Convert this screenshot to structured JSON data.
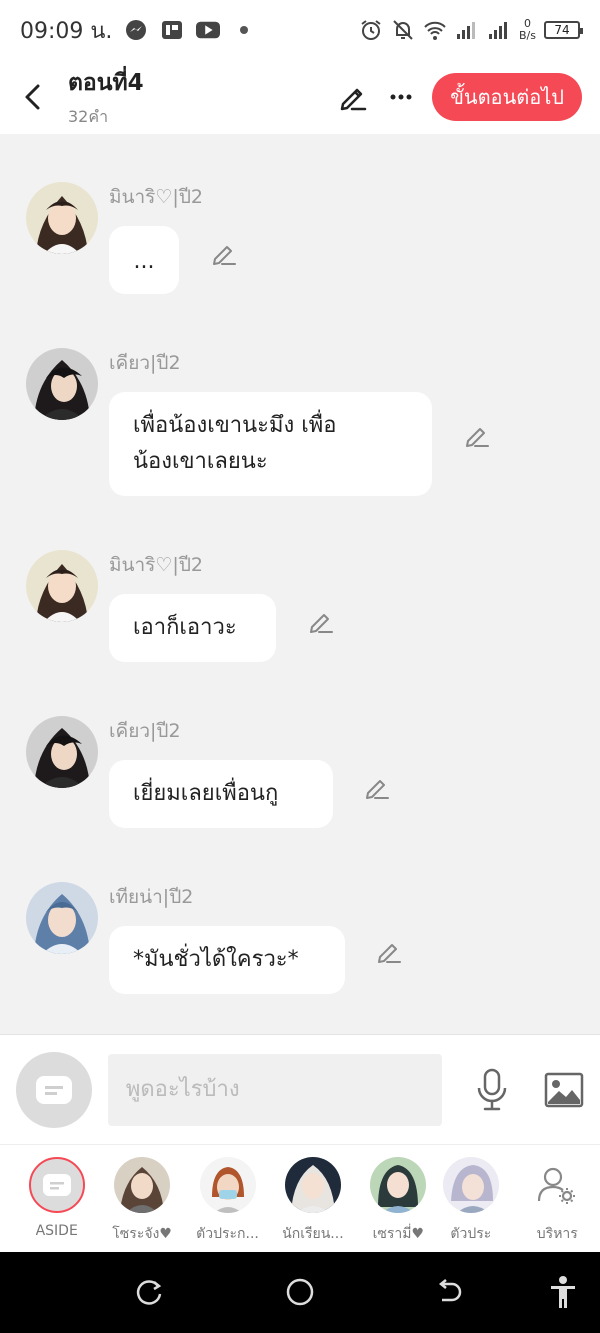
{
  "status_bar": {
    "time": "09:09 น.",
    "net_speed_value": "0",
    "net_speed_unit": "B/s",
    "battery": "74"
  },
  "header": {
    "title": "ตอนที่4",
    "subtitle": "32คำ",
    "next_label": "ขั้นตอนต่อไป"
  },
  "messages": [
    {
      "sender": "มินาริ♡|ปี2",
      "text": "..."
    },
    {
      "sender": "เคียว|ปี2",
      "text_line1": "เพื่อน้องเขานะมึง เพื่อ",
      "text_line2": "น้องเขาเลยนะ"
    },
    {
      "sender": "มินาริ♡|ปี2",
      "text": "เอาก็เอาวะ"
    },
    {
      "sender": "เคียว|ปี2",
      "text": "เยี่ยมเลยเพื่อนกู"
    },
    {
      "sender": "เทียน่า|ปี2",
      "text": "*มันชั่วได้ใครวะ*"
    }
  ],
  "input": {
    "placeholder": "พูดอะไรบ้าง"
  },
  "characters": [
    {
      "name": "ASIDE"
    },
    {
      "name": "โซระจัง♥"
    },
    {
      "name": "ตัวประก..."
    },
    {
      "name": "นักเรียน..."
    },
    {
      "name": "เซรามี่♥"
    },
    {
      "name": "ตัวประ"
    },
    {
      "name": "บริหาร"
    }
  ],
  "colors": {
    "accent": "#f54a55",
    "background": "#f2f2f2"
  }
}
